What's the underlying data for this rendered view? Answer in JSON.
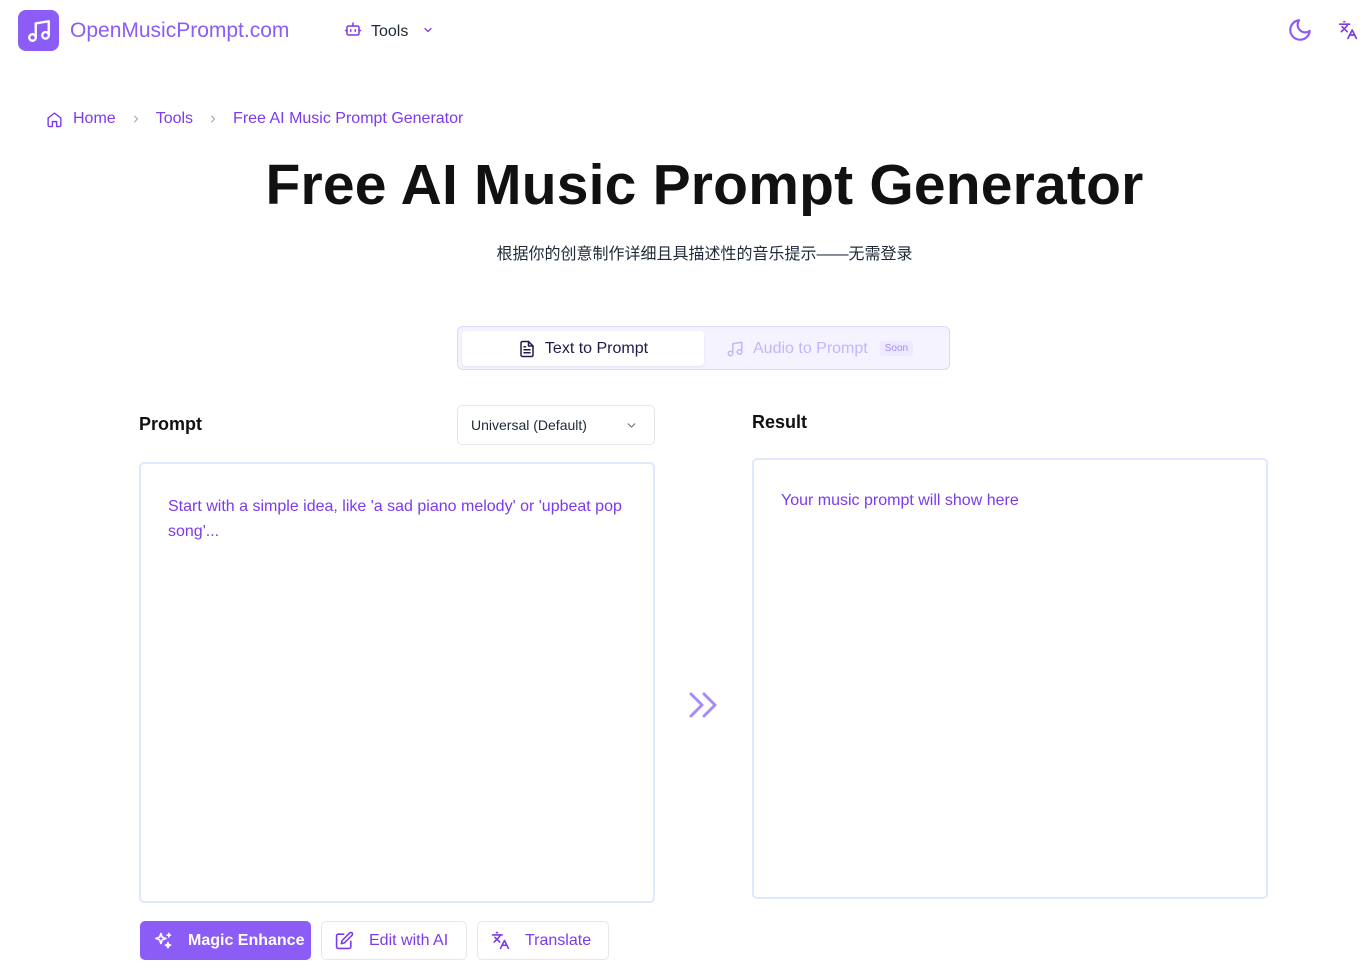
{
  "header": {
    "site_name": "OpenMusicPrompt.com",
    "tools_label": "Tools"
  },
  "breadcrumb": {
    "items": [
      "Home",
      "Tools",
      "Free AI Music Prompt Generator"
    ]
  },
  "hero": {
    "title": "Free AI Music Prompt Generator",
    "subtitle": "根据你的创意制作详细且具描述性的音乐提示——无需登录"
  },
  "mode_tabs": {
    "text_to_prompt": "Text to Prompt",
    "audio_to_prompt": "Audio to Prompt",
    "soon_badge": "Soon"
  },
  "prompt_panel": {
    "label": "Prompt",
    "style_selected": "Universal (Default)",
    "placeholder": "Start with a simple idea, like 'a sad piano melody' or 'upbeat pop song'..."
  },
  "result_panel": {
    "label": "Result",
    "placeholder": "Your music prompt will show here"
  },
  "actions": {
    "magic_enhance": "Magic Enhance",
    "edit_with_ai": "Edit with AI",
    "translate": "Translate"
  },
  "colors": {
    "accent": "#8b5cf6",
    "accent_dark": "#7c3aed",
    "panel_border": "#e0e7ff"
  }
}
